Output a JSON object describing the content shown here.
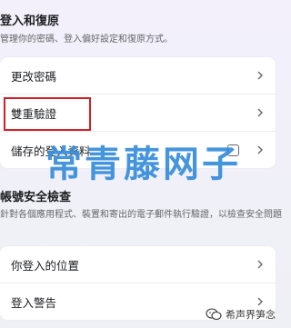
{
  "login_section": {
    "title": "登入和復原",
    "description": "管理你的密碼、登入偏好設定和復原方式。",
    "items": [
      {
        "label": "更改密碼"
      },
      {
        "label": "雙重驗證"
      },
      {
        "label": "儲存的登入資料"
      }
    ]
  },
  "security_section": {
    "title": "帳號安全檢查",
    "description": "針對各個應用程式、裝置和寄出的電子郵件執行驗證，以檢查安全問題",
    "items": [
      {
        "label": "你登入的位置"
      },
      {
        "label": "登入警告"
      }
    ]
  },
  "watermark": {
    "text": "常青藤网子"
  },
  "brand": {
    "text": "希声界笋念"
  },
  "icons": {
    "chevron": "chevron-right-icon",
    "saved_login": "square-icon",
    "brand": "wechat-logo-icon"
  },
  "colors": {
    "highlight": "#d11f27",
    "watermark": "#1c7ed6"
  }
}
